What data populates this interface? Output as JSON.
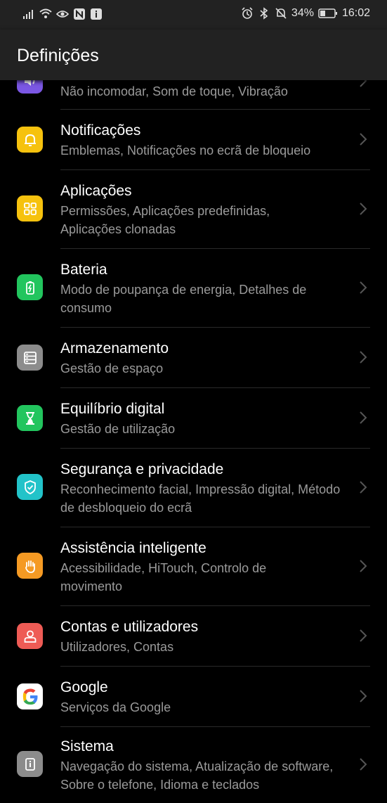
{
  "status": {
    "battery_pct": "34%",
    "time": "16:02"
  },
  "header": {
    "title": "Definições"
  },
  "items": [
    {
      "title": "",
      "subtitle": "Não incomodar, Som de toque, Vibração",
      "icon": "sound-icon",
      "color": "#7b57e4"
    },
    {
      "title": "Notificações",
      "subtitle": "Emblemas, Notificações no ecrã de bloqueio",
      "icon": "bell-icon",
      "color": "#f6c20e"
    },
    {
      "title": "Aplicações",
      "subtitle": "Permissões, Aplicações predefinidas, Aplicações clonadas",
      "icon": "apps-grid-icon",
      "color": "#f6c20e"
    },
    {
      "title": "Bateria",
      "subtitle": "Modo de poupança de energia, Detalhes de consumo",
      "icon": "battery-icon",
      "color": "#22c55e"
    },
    {
      "title": "Armazenamento",
      "subtitle": "Gestão de espaço",
      "icon": "storage-icon",
      "color": "#8c8c8c"
    },
    {
      "title": "Equilíbrio digital",
      "subtitle": "Gestão de utilização",
      "icon": "hourglass-icon",
      "color": "#22c55e"
    },
    {
      "title": "Segurança e privacidade",
      "subtitle": "Reconhecimento facial, Impressão digital, Método de desbloqueio do ecrã",
      "icon": "shield-icon",
      "color": "#22c3c9"
    },
    {
      "title": "Assistência inteligente",
      "subtitle": "Acessibilidade, HiTouch, Controlo de movimento",
      "icon": "hand-icon",
      "color": "#f59a23"
    },
    {
      "title": "Contas e utilizadores",
      "subtitle": "Utilizadores, Contas",
      "icon": "user-icon",
      "color": "#ee5b55"
    },
    {
      "title": "Google",
      "subtitle": "Serviços da Google",
      "icon": "google-icon",
      "color": "#ffffff"
    },
    {
      "title": "Sistema",
      "subtitle": "Navegação do sistema, Atualização de software, Sobre o telefone, Idioma e teclados",
      "icon": "system-info-icon",
      "color": "#8c8c8c"
    }
  ]
}
